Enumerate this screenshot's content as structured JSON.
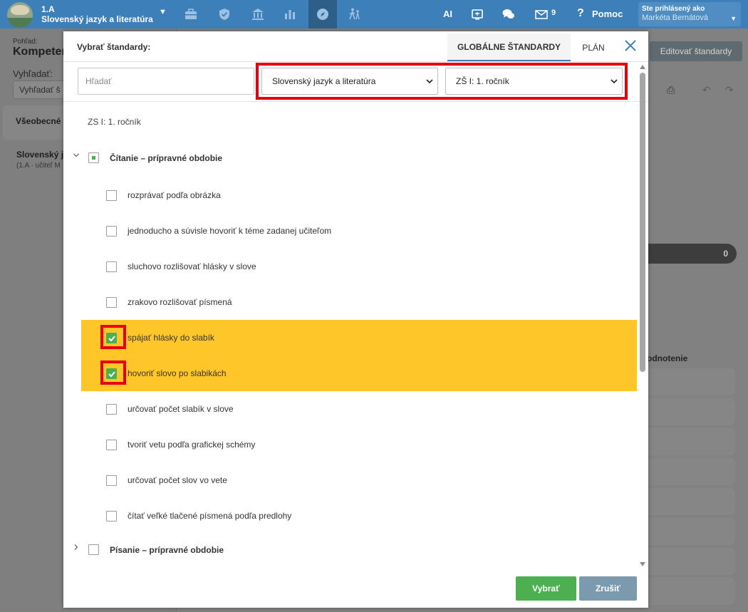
{
  "topbar": {
    "class_name": "1.A",
    "subject": "Slovenský jazyk a literatúra",
    "ai_label": "AI",
    "mail_count": "9",
    "help_label": "Pomoc",
    "user_caption": "Ste prihlásený ako",
    "user_name": "Markéta Bernátová",
    "nav_icons": [
      "briefcase-icon",
      "shield-check-icon",
      "institution-icon",
      "bar-chart-icon",
      "compass-icon",
      "walking-kids-icon",
      "cast-screen-icon",
      "chat-bubbles-icon",
      "mail-icon",
      "question-icon"
    ]
  },
  "background": {
    "view_caption": "Pohľad:",
    "view_title": "Kompeten",
    "search_caption": "Vyhľadať:",
    "search_placeholder": "Vyhľadať š",
    "card_label": "Všeobecné",
    "subject_label": "Slovenský ja",
    "subject_sub": "(1.A · učiteľ M",
    "edit_button": "Editovať štandardy",
    "counter": "0",
    "column_header": "odnotenie"
  },
  "modal": {
    "title": "Vybrať štandardy:",
    "tabs": [
      "GLOBÁLNE ŠTANDARDY",
      "PLÁN"
    ],
    "active_tab": "GLOBÁLNE ŠTANDARDY",
    "search_placeholder": "Hľadať",
    "subject_select": "Slovenský jazyk a literatúra",
    "grade_select": "ZŠ I: 1. ročník",
    "heading": "ZS I: 1. ročník",
    "groups": [
      {
        "label": "Čítanie – prípravné obdobie",
        "expanded": true,
        "state": "partial"
      },
      {
        "label": "Písanie – prípravné obdobie",
        "expanded": false,
        "state": "unchecked"
      }
    ],
    "items": [
      {
        "label": "rozprávať podľa obrázka",
        "checked": false
      },
      {
        "label": "jednoducho a súvisle hovoriť k téme zadanej učiteľom",
        "checked": false
      },
      {
        "label": "sluchovo rozlišovať hlásky v slove",
        "checked": false
      },
      {
        "label": "zrakovo rozlišovať písmená",
        "checked": false
      },
      {
        "label": "spájať hlásky do slabík",
        "checked": true
      },
      {
        "label": "hovoriť slovo po slabikách",
        "checked": true
      },
      {
        "label": "určovať počet slabík v slove",
        "checked": false
      },
      {
        "label": "tvoriť vetu podľa grafickej schémy",
        "checked": false
      },
      {
        "label": "určovať počet slov vo vete",
        "checked": false
      },
      {
        "label": "čítať veľké tlačené písmená podľa predlohy",
        "checked": false
      }
    ],
    "ok_button": "Vybrať",
    "cancel_button": "Zrušiť"
  },
  "colors": {
    "topbar": "#3d7fb8",
    "highlight_row": "#ffc629",
    "checkbox_checked": "#4caf50",
    "annotation_red": "#e8000e",
    "ok_button": "#4caf50",
    "cancel_button": "#7b9aad"
  }
}
